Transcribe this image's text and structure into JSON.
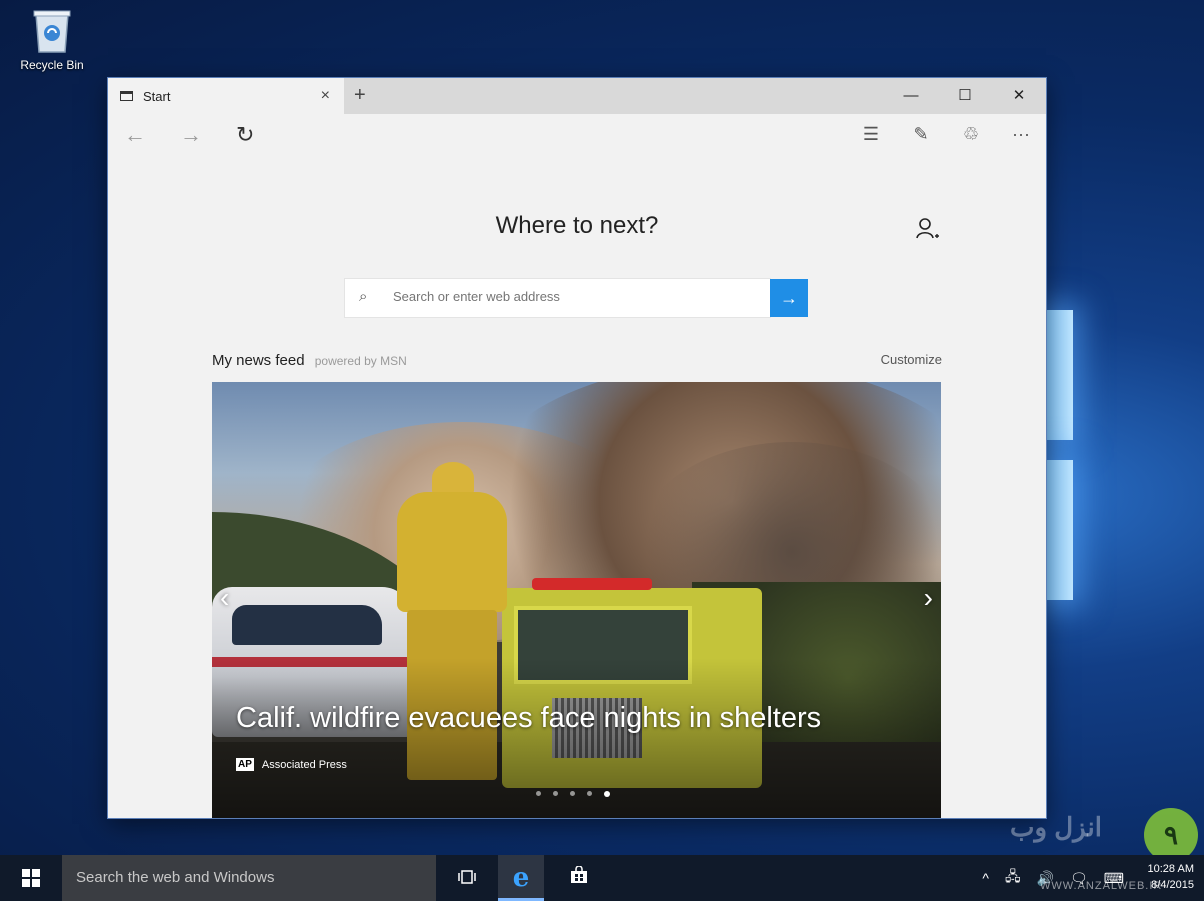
{
  "desktop": {
    "recycle_bin_label": "Recycle Bin"
  },
  "browser": {
    "tab_title": "Start",
    "tab_close": "×",
    "new_tab": "+",
    "window_controls": {
      "minimize": "—",
      "maximize": "☐",
      "close": "✕"
    },
    "nav": {
      "back": "←",
      "forward": "→",
      "refresh": "↻"
    },
    "toolbar": {
      "hub": "☰",
      "note": "✎",
      "share": "♲",
      "more": "···"
    }
  },
  "start_page": {
    "heading": "Where to next?",
    "search": {
      "placeholder": "Search or enter web address",
      "go": "→"
    },
    "feed": {
      "title": "My news feed",
      "powered_by": "powered by MSN",
      "customize": "Customize"
    },
    "story": {
      "headline": "Calif. wildfire evacuees face nights in shelters",
      "source_badge": "AP",
      "source": "Associated Press",
      "prev": "‹",
      "next": "›",
      "slide_count": 5,
      "active_slide": 5
    }
  },
  "taskbar": {
    "search_placeholder": "Search the web and Windows",
    "edge_glyph": "e",
    "tray": {
      "chevron": "^",
      "network": "🖧",
      "volume": "🔊",
      "action": "🗨",
      "keyboard": "⌨"
    },
    "time": "10:28 AM",
    "date": "8/4/2015"
  },
  "watermark": {
    "badge": "٩",
    "text": "انزل وب",
    "url": "WWW.ANZALWEB.IR"
  },
  "colors": {
    "accent": "#1f8ee6",
    "taskbar": "#101a2a",
    "browser_bg": "#f2f2f2"
  }
}
